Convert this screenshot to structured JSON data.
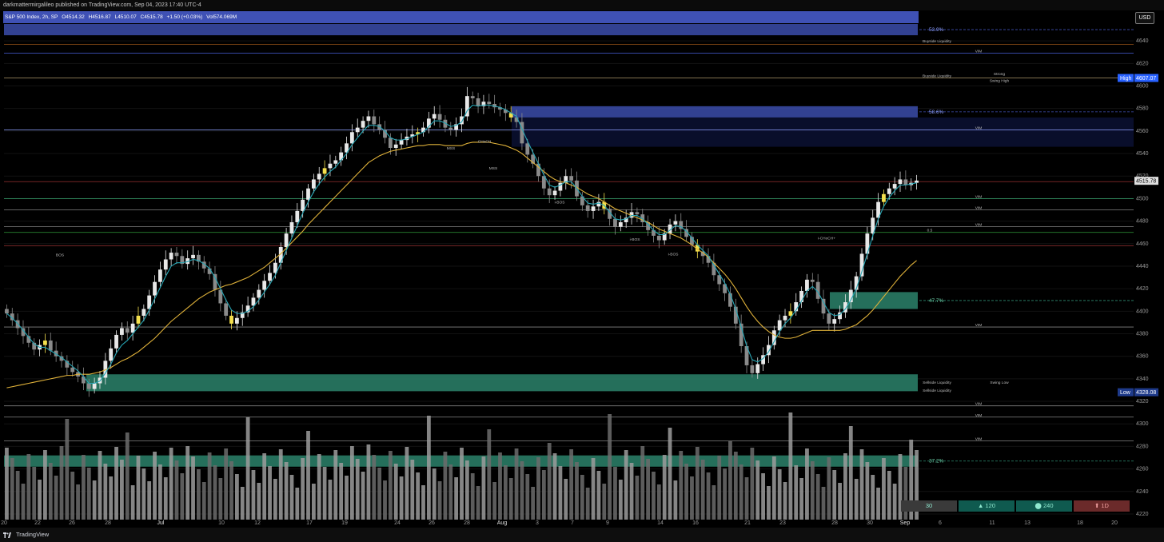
{
  "header": {
    "published": "darkmattermirgalileo published on TradingView.com, Sep 04, 2023 17:40 UTC-4"
  },
  "legend": {
    "symbol": "S&P 500 Index, 2h, SP",
    "open": "O4514.32",
    "high": "H4516.87",
    "low": "L4510.07",
    "close": "C4515.78",
    "change": "+1.50 (+0.03%)",
    "volume": "Vol574.069M"
  },
  "currency_button": "USD",
  "footer": {
    "brand": "TradingView"
  },
  "toolbar_pills": [
    "30",
    "▲ 120",
    "⬤ 240",
    "⬆ 1D"
  ],
  "colors": {
    "background": "#000000",
    "up_candle": "#e8e8e8",
    "down_candle": "#8a8a8a",
    "highlight_candle": "#f4e04d",
    "ema_fast": "#26a6b5",
    "ema_slow": "#e0b23a",
    "supply_zone": "#3f51b5",
    "demand_zone": "#2e8b72",
    "label_high": "#2962ff"
  },
  "chart_data": {
    "type": "candlestick",
    "timeframe": "2h",
    "ylim": [
      4215,
      4655
    ],
    "y_ticks": [
      4640,
      4620,
      4600,
      4580,
      4560,
      4540,
      4520,
      4500,
      4480,
      4460,
      4440,
      4420,
      4400,
      4380,
      4360,
      4340,
      4320,
      4300,
      4280,
      4260,
      4240,
      4220
    ],
    "x_ticks": [
      "20",
      "22",
      "26",
      "28",
      "Jul",
      "10",
      "12",
      "17",
      "19",
      "24",
      "26",
      "28",
      "Aug",
      "3",
      "7",
      "9",
      "14",
      "16",
      "21",
      "23",
      "28",
      "30",
      "Sep",
      "6",
      "11",
      "13",
      "18",
      "20"
    ],
    "last_price": "4515.78",
    "high_label": {
      "text": "High",
      "value": "4607.07"
    },
    "low_label": {
      "text": "Low",
      "value": "4328.08"
    },
    "close_series": [
      4398,
      4392,
      4385,
      4378,
      4372,
      4366,
      4370,
      4374,
      4365,
      4360,
      4356,
      4350,
      4346,
      4342,
      4336,
      4331,
      4336,
      4341,
      4356,
      4367,
      4379,
      4385,
      4381,
      4389,
      4396,
      4402,
      4414,
      4426,
      4437,
      4446,
      4452,
      4449,
      4442,
      4447,
      4450,
      4444,
      4438,
      4433,
      4419,
      4407,
      4396,
      4389,
      4394,
      4399,
      4405,
      4412,
      4419,
      4427,
      4434,
      4443,
      4457,
      4469,
      4479,
      4489,
      4499,
      4509,
      4517,
      4522,
      4527,
      4531,
      4534,
      4541,
      4549,
      4559,
      4563,
      4569,
      4573,
      4566,
      4561,
      4554,
      4545,
      4548,
      4552,
      4555,
      4557,
      4559,
      4563,
      4571,
      4575,
      4570,
      4563,
      4561,
      4566,
      4573,
      4591,
      4589,
      4582,
      4586,
      4584,
      4581,
      4579,
      4576,
      4572,
      4568,
      4549,
      4539,
      4531,
      4520,
      4509,
      4503,
      4507,
      4514,
      4520,
      4516,
      4502,
      4494,
      4489,
      4493,
      4497,
      4491,
      4482,
      4475,
      4479,
      4483,
      4488,
      4486,
      4479,
      4472,
      4467,
      4463,
      4469,
      4477,
      4480,
      4473,
      4466,
      4459,
      4453,
      4449,
      4443,
      4432,
      4424,
      4416,
      4404,
      4389,
      4369,
      4352,
      4345,
      4353,
      4361,
      4370,
      4383,
      4392,
      4396,
      4400,
      4408,
      4418,
      4428,
      4426,
      4411,
      4398,
      4389,
      4393,
      4399,
      4408,
      4419,
      4431,
      4451,
      4469,
      4483,
      4497,
      4504,
      4509,
      4513,
      4517,
      4512,
      4514,
      4516
    ],
    "ema_fast": [
      4398,
      4394,
      4389,
      4383,
      4377,
      4371,
      4368,
      4368,
      4365,
      4362,
      4359,
      4355,
      4351,
      4347,
      4342,
      4336,
      4336,
      4338,
      4345,
      4353,
      4363,
      4370,
      4374,
      4380,
      4386,
      4392,
      4401,
      4411,
      4421,
      4431,
      4440,
      4443,
      4443,
      4444,
      4446,
      4445,
      4442,
      4438,
      4430,
      4420,
      4410,
      4401,
      4398,
      4398,
      4400,
      4404,
      4410,
      4417,
      4424,
      4432,
      4443,
      4454,
      4465,
      4476,
      4487,
      4497,
      4506,
      4513,
      4519,
      4524,
      4528,
      4534,
      4540,
      4548,
      4554,
      4560,
      4565,
      4565,
      4564,
      4560,
      4554,
      4552,
      4552,
      4553,
      4555,
      4557,
      4559,
      4564,
      4569,
      4569,
      4567,
      4564,
      4565,
      4568,
      4578,
      4583,
      4582,
      4583,
      4583,
      4582,
      4581,
      4579,
      4576,
      4573,
      4562,
      4551,
      4541,
      4531,
      4521,
      4512,
      4510,
      4512,
      4515,
      4515,
      4509,
      4502,
      4496,
      4495,
      4496,
      4494,
      4488,
      4482,
      4481,
      4482,
      4485,
      4485,
      4482,
      4477,
      4472,
      4468,
      4468,
      4472,
      4476,
      4475,
      4471,
      4465,
      4459,
      4454,
      4449,
      4441,
      4433,
      4425,
      4415,
      4402,
      4386,
      4369,
      4357,
      4355,
      4358,
      4364,
      4373,
      4382,
      4389,
      4394,
      4401,
      4409,
      4418,
      4422,
      4417,
      4408,
      4399,
      4396,
      4397,
      4402,
      4410,
      4420,
      4435,
      4451,
      4467,
      4482,
      4493,
      4501,
      4507,
      4512,
      4512,
      4513,
      4514
    ],
    "ema_slow": [
      4332,
      4333,
      4334,
      4335,
      4336,
      4337,
      4338,
      4339,
      4340,
      4341,
      4342,
      4343,
      4343,
      4344,
      4344,
      4344,
      4345,
      4346,
      4348,
      4350,
      4353,
      4356,
      4358,
      4361,
      4364,
      4368,
      4372,
      4376,
      4381,
      4386,
      4391,
      4395,
      4399,
      4403,
      4407,
      4411,
      4414,
      4417,
      4419,
      4421,
      4423,
      4424,
      4426,
      4428,
      4430,
      4433,
      4436,
      4439,
      4443,
      4447,
      4451,
      4456,
      4461,
      4466,
      4471,
      4477,
      4482,
      4487,
      4492,
      4497,
      4502,
      4507,
      4512,
      4517,
      4522,
      4527,
      4532,
      4535,
      4538,
      4540,
      4542,
      4543,
      4544,
      4545,
      4546,
      4547,
      4547,
      4548,
      4548,
      4548,
      4547,
      4547,
      4547,
      4547,
      4549,
      4550,
      4550,
      4550,
      4550,
      4549,
      4548,
      4547,
      4545,
      4543,
      4540,
      4536,
      4532,
      4528,
      4524,
      4520,
      4517,
      4515,
      4514,
      4512,
      4510,
      4507,
      4504,
      4502,
      4500,
      4497,
      4494,
      4491,
      4489,
      4487,
      4485,
      4483,
      4481,
      4479,
      4476,
      4473,
      4471,
      4469,
      4467,
      4465,
      4462,
      4459,
      4455,
      4452,
      4448,
      4443,
      4438,
      4433,
      4427,
      4420,
      4412,
      4404,
      4397,
      4391,
      4386,
      4382,
      4379,
      4377,
      4376,
      4376,
      4377,
      4379,
      4381,
      4383,
      4383,
      4383,
      4383,
      4383,
      4383,
      4384,
      4386,
      4388,
      4392,
      4396,
      4401,
      4407,
      4413,
      4419,
      4425,
      4431,
      4436,
      4441,
      4445
    ],
    "zones": [
      {
        "kind": "supply",
        "label": "53.9%",
        "top": 4655,
        "bottom": 4645
      },
      {
        "kind": "supply",
        "label": "58.6%",
        "top": 4582,
        "bottom": 4572,
        "shadow_bottom": 4546
      },
      {
        "kind": "demand",
        "label": "47.7%",
        "top": 4417,
        "bottom": 4402
      },
      {
        "kind": "demand",
        "label": "",
        "top": 4344,
        "bottom": 4329
      },
      {
        "kind": "demand",
        "label": "37.2%",
        "top": 4272,
        "bottom": 4262
      }
    ],
    "annotations": [
      {
        "text": "BOS",
        "price": 4448
      },
      {
        "text": "CHoCH",
        "price": 4549
      },
      {
        "text": "MSS",
        "price": 4543
      },
      {
        "text": "MSS",
        "price": 4525
      },
      {
        "text": "i-BOS",
        "price": 4495
      },
      {
        "text": "i-BOS",
        "price": 4462
      },
      {
        "text": "i-BOS",
        "price": 4449
      },
      {
        "text": "i-CHoCH+",
        "price": 4463
      },
      {
        "text": "Buyside  Liquidity",
        "price": 4638
      },
      {
        "text": "Buyside  Liquidity",
        "price": 4607
      },
      {
        "text": "Strong",
        "price": 4609
      },
      {
        "text": "Swing High",
        "price": 4603
      },
      {
        "text": "Sellside  Liquidity",
        "price": 4335
      },
      {
        "text": "Sellside  Liquidity",
        "price": 4328
      },
      {
        "text": "Swing Low",
        "price": 4335
      },
      {
        "text": "0.5",
        "price": 4470
      },
      {
        "text": "VIM",
        "price": 4629
      },
      {
        "text": "VIM",
        "price": 4561
      },
      {
        "text": "VIM",
        "price": 4500
      },
      {
        "text": "VIM",
        "price": 4490
      },
      {
        "text": "VIM",
        "price": 4475
      },
      {
        "text": "VIM",
        "price": 4386
      },
      {
        "text": "VIM",
        "price": 4316
      },
      {
        "text": "VIM",
        "price": 4306
      },
      {
        "text": "VIM",
        "price": 4285
      }
    ],
    "horizontal_levels": [
      {
        "price": 4637,
        "color": "#b5651d"
      },
      {
        "price": 4629,
        "color": "#5470ff"
      },
      {
        "price": 4607,
        "color": "#c9b27c"
      },
      {
        "price": 4561,
        "color": "#8fa0ff"
      },
      {
        "price": 4515,
        "color": "#b23a3a"
      },
      {
        "price": 4500,
        "color": "#3fbf7f"
      },
      {
        "price": 4490,
        "color": "#9a9a9a"
      },
      {
        "price": 4475,
        "color": "#9a9a9a"
      },
      {
        "price": 4470,
        "color": "#2e9a3a"
      },
      {
        "price": 4458,
        "color": "#b23a3a"
      },
      {
        "price": 4386,
        "color": "#9a9a9a"
      },
      {
        "price": 4316,
        "color": "#9a9a9a"
      },
      {
        "price": 4306,
        "color": "#9a9a9a"
      },
      {
        "price": 4285,
        "color": "#9a9a9a"
      }
    ]
  }
}
